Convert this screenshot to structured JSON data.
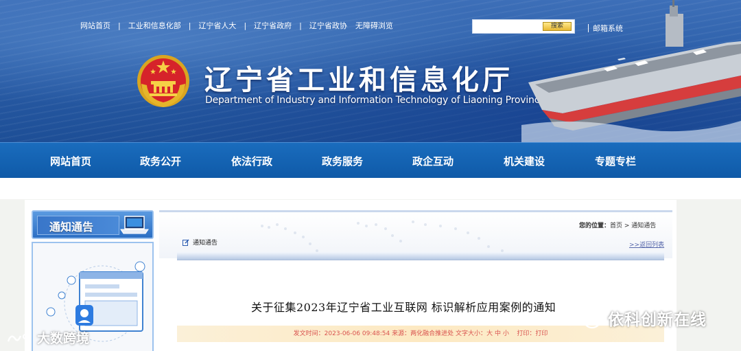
{
  "top_links": [
    "网站首页",
    "工业和信息化部",
    "辽宁省人大",
    "辽宁省政府",
    "辽宁省政协",
    "无障碍浏览"
  ],
  "search": {
    "placeholder": "",
    "button": "搜索"
  },
  "mail_link": "邮箱系统",
  "site": {
    "title_cn": "辽宁省工业和信息化厅",
    "title_en": "Department of Industry and Information Technology of Liaoning Province"
  },
  "nav": [
    "网站首页",
    "政务公开",
    "依法行政",
    "政务服务",
    "政企互动",
    "机关建设",
    "专题专栏"
  ],
  "sidebar": {
    "heading": "通知通告"
  },
  "panel": {
    "location_label": "您的位置：",
    "location_path": "首页 > 通知通告",
    "section_title": "通知通告",
    "back_link": ">>返回列表"
  },
  "article": {
    "title": "关于征集2023年辽宁省工业互联网 标识解析应用案例的通知",
    "meta_date_label": "发文时间：",
    "meta_date": "2023-06-06 09:48:54",
    "meta_source_label": "来源：",
    "meta_source": "两化融合推进处",
    "meta_fontsize_label": "文字大小：",
    "meta_fontsize_options": [
      "大",
      "中",
      "小"
    ],
    "meta_print_label": "打印：",
    "meta_print": "打印"
  },
  "watermarks": {
    "left": "大数跨境",
    "right": "依科创新在线"
  },
  "colors": {
    "nav_blue": "#0f5aa8",
    "banner_blue": "#2b5ea8",
    "meta_red": "#d9534f",
    "meta_bg": "#fde9c2"
  }
}
